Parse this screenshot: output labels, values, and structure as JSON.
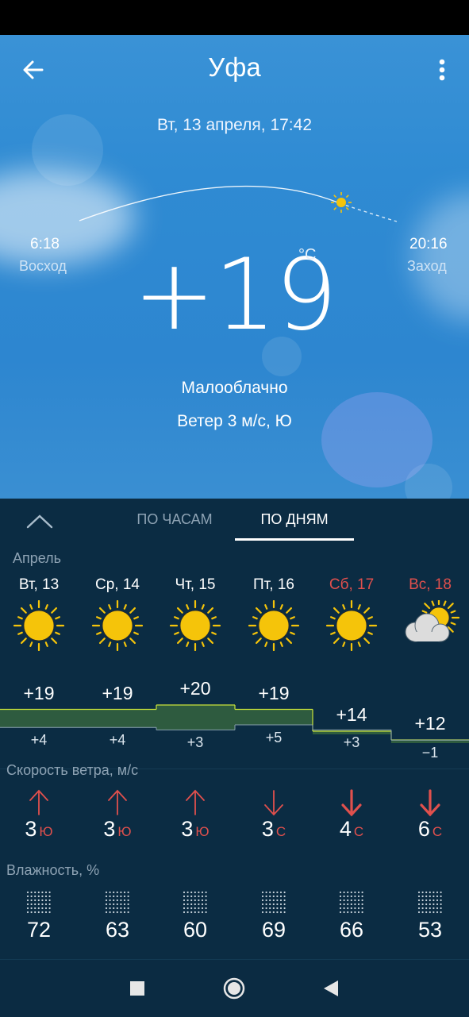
{
  "header": {
    "city": "Уфа",
    "datetime": "Вт, 13 апреля, 17:42",
    "back_icon": "arrow-left-icon",
    "menu_icon": "more-vertical-icon"
  },
  "current": {
    "sunrise_time": "6:18",
    "sunrise_label": "Восход",
    "sunset_time": "20:16",
    "sunset_label": "Заход",
    "sign": "+",
    "temp": "19",
    "unit": "°C",
    "condition": "Малооблачно",
    "wind": "Ветер 3 м/с, Ю"
  },
  "tabs": {
    "hourly": "ПО ЧАСАМ",
    "daily": "ПО ДНЯМ",
    "active": "daily"
  },
  "month": "Апрель",
  "days": [
    {
      "label": "Вт, 13",
      "weekend": false,
      "icon": "sun-icon",
      "max": "+19",
      "min": "+4",
      "wind_speed": "3",
      "wind_dir": "Ю",
      "wind_arrow": "arrow-up-icon",
      "humidity": "72"
    },
    {
      "label": "Ср, 14",
      "weekend": false,
      "icon": "sun-icon",
      "max": "+19",
      "min": "+4",
      "wind_speed": "3",
      "wind_dir": "Ю",
      "wind_arrow": "arrow-up-icon",
      "humidity": "63"
    },
    {
      "label": "Чт, 15",
      "weekend": false,
      "icon": "sun-icon",
      "max": "+20",
      "min": "+3",
      "wind_speed": "3",
      "wind_dir": "Ю",
      "wind_arrow": "arrow-up-icon",
      "humidity": "60"
    },
    {
      "label": "Пт, 16",
      "weekend": false,
      "icon": "sun-icon",
      "max": "+19",
      "min": "+5",
      "wind_speed": "3",
      "wind_dir": "С",
      "wind_arrow": "arrow-down-icon",
      "humidity": "69"
    },
    {
      "label": "Сб, 17",
      "weekend": true,
      "icon": "sun-icon",
      "max": "+14",
      "min": "+3",
      "wind_speed": "4",
      "wind_dir": "С",
      "wind_arrow": "arrow-down-icon",
      "humidity": "66"
    },
    {
      "label": "Вс, 18",
      "weekend": true,
      "icon": "partly-cloudy-icon",
      "max": "+12",
      "min": "−1",
      "wind_speed": "6",
      "wind_dir": "С",
      "wind_arrow": "arrow-down-icon",
      "humidity": "53"
    }
  ],
  "labels": {
    "wind_speed": "Скорость ветра, м/с",
    "humidity": "Влажность, %"
  },
  "navbar": {
    "recents_icon": "square-icon",
    "home_icon": "circle-icon",
    "back_icon": "triangle-back-icon"
  },
  "colors": {
    "sky": "#2f8bd3",
    "panel": "#0b2c43",
    "weekend": "#e0504d",
    "temp_band": "#2e5b3f",
    "temp_line": "#c9e23a",
    "sun": "#f5c40a"
  }
}
